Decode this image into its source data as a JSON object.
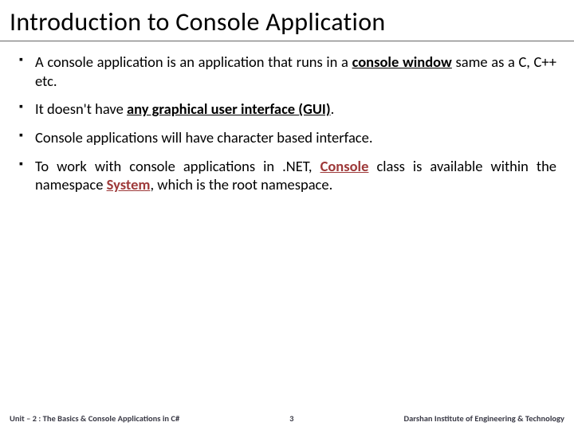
{
  "title": "Introduction to Console Application",
  "bullets": {
    "b1": {
      "t1": "A console application is an application that runs in a ",
      "t2": "console window",
      "t3": " same as a C, C++ etc."
    },
    "b2": {
      "t1": "It doesn't have ",
      "t2": "any graphical user interface (GUI)",
      "t3": "."
    },
    "b3": {
      "t1": "Console applications will have character based interface."
    },
    "b4": {
      "t1": "To work with console applications in .NET, ",
      "t2": "Console",
      "t3": " class is available within the namespace ",
      "t4": "System",
      "t5": ", which is the root namespace."
    }
  },
  "footer": {
    "left": "Unit – 2 : The Basics & Console Applications in C#",
    "center": "3",
    "right": "Darshan Institute of Engineering & Technology"
  }
}
